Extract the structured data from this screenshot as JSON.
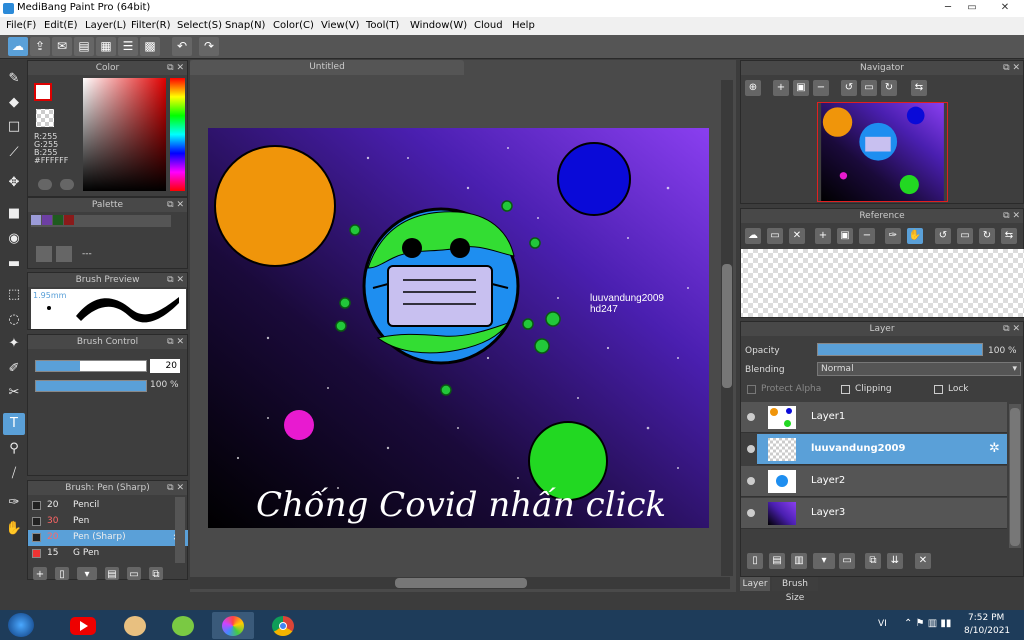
{
  "window": {
    "title": "MediBang Paint Pro (64bit)"
  },
  "menu": [
    "File(F)",
    "Edit(E)",
    "Layer(L)",
    "Filter(R)",
    "Select(S)",
    "Snap(N)",
    "Color(C)",
    "View(V)",
    "Tool(T)",
    "Window(W)",
    "Cloud",
    "Help"
  ],
  "document": {
    "tab_title": "Untitled"
  },
  "color_panel": {
    "title": "Color",
    "r": "R:255",
    "g": "G:255",
    "b": "B:255",
    "hex": "#FFFFFF",
    "accent": "#5aa0d8"
  },
  "palette_panel": {
    "title": "Palette",
    "dash": "---"
  },
  "brush_preview": {
    "title": "Brush Preview",
    "size": "1.95mm"
  },
  "brush_control": {
    "title": "Brush Control",
    "size_value": "20",
    "opacity_value": "100 %"
  },
  "brush_list": {
    "title": "Brush: Pen (Sharp)",
    "items": [
      {
        "num": "20",
        "name": "Pencil",
        "color": "#ffffff"
      },
      {
        "num": "30",
        "name": "Pen",
        "color": "#ff6666"
      },
      {
        "num": "20",
        "name": "Pen (Sharp)",
        "color": "#ff6666"
      },
      {
        "num": "15",
        "name": "G Pen",
        "color": "#ffffff"
      }
    ]
  },
  "artwork": {
    "author_text": "luuvandung2009",
    "author_sub": "hd247",
    "caption": "Chống Covid nhấn click"
  },
  "navigator": {
    "title": "Navigator"
  },
  "reference": {
    "title": "Reference"
  },
  "layer_panel": {
    "title": "Layer",
    "opacity_label": "Opacity",
    "opacity_value": "100 %",
    "opacity_fraction": 1.0,
    "blending_label": "Blending",
    "blending_value": "Normal",
    "protect_alpha": "Protect Alpha",
    "clipping": "Clipping",
    "lock": "Lock",
    "layers": [
      {
        "name": "Layer1",
        "selected": false
      },
      {
        "name": "luuvandung2009",
        "selected": true
      },
      {
        "name": "Layer2",
        "selected": false
      },
      {
        "name": "Layer3",
        "selected": false
      }
    ],
    "bottom_tabs": [
      "Layer",
      "Brush Size"
    ]
  },
  "taskbar": {
    "lang": "VI",
    "time": "7:52 PM",
    "date": "8/10/2021"
  }
}
